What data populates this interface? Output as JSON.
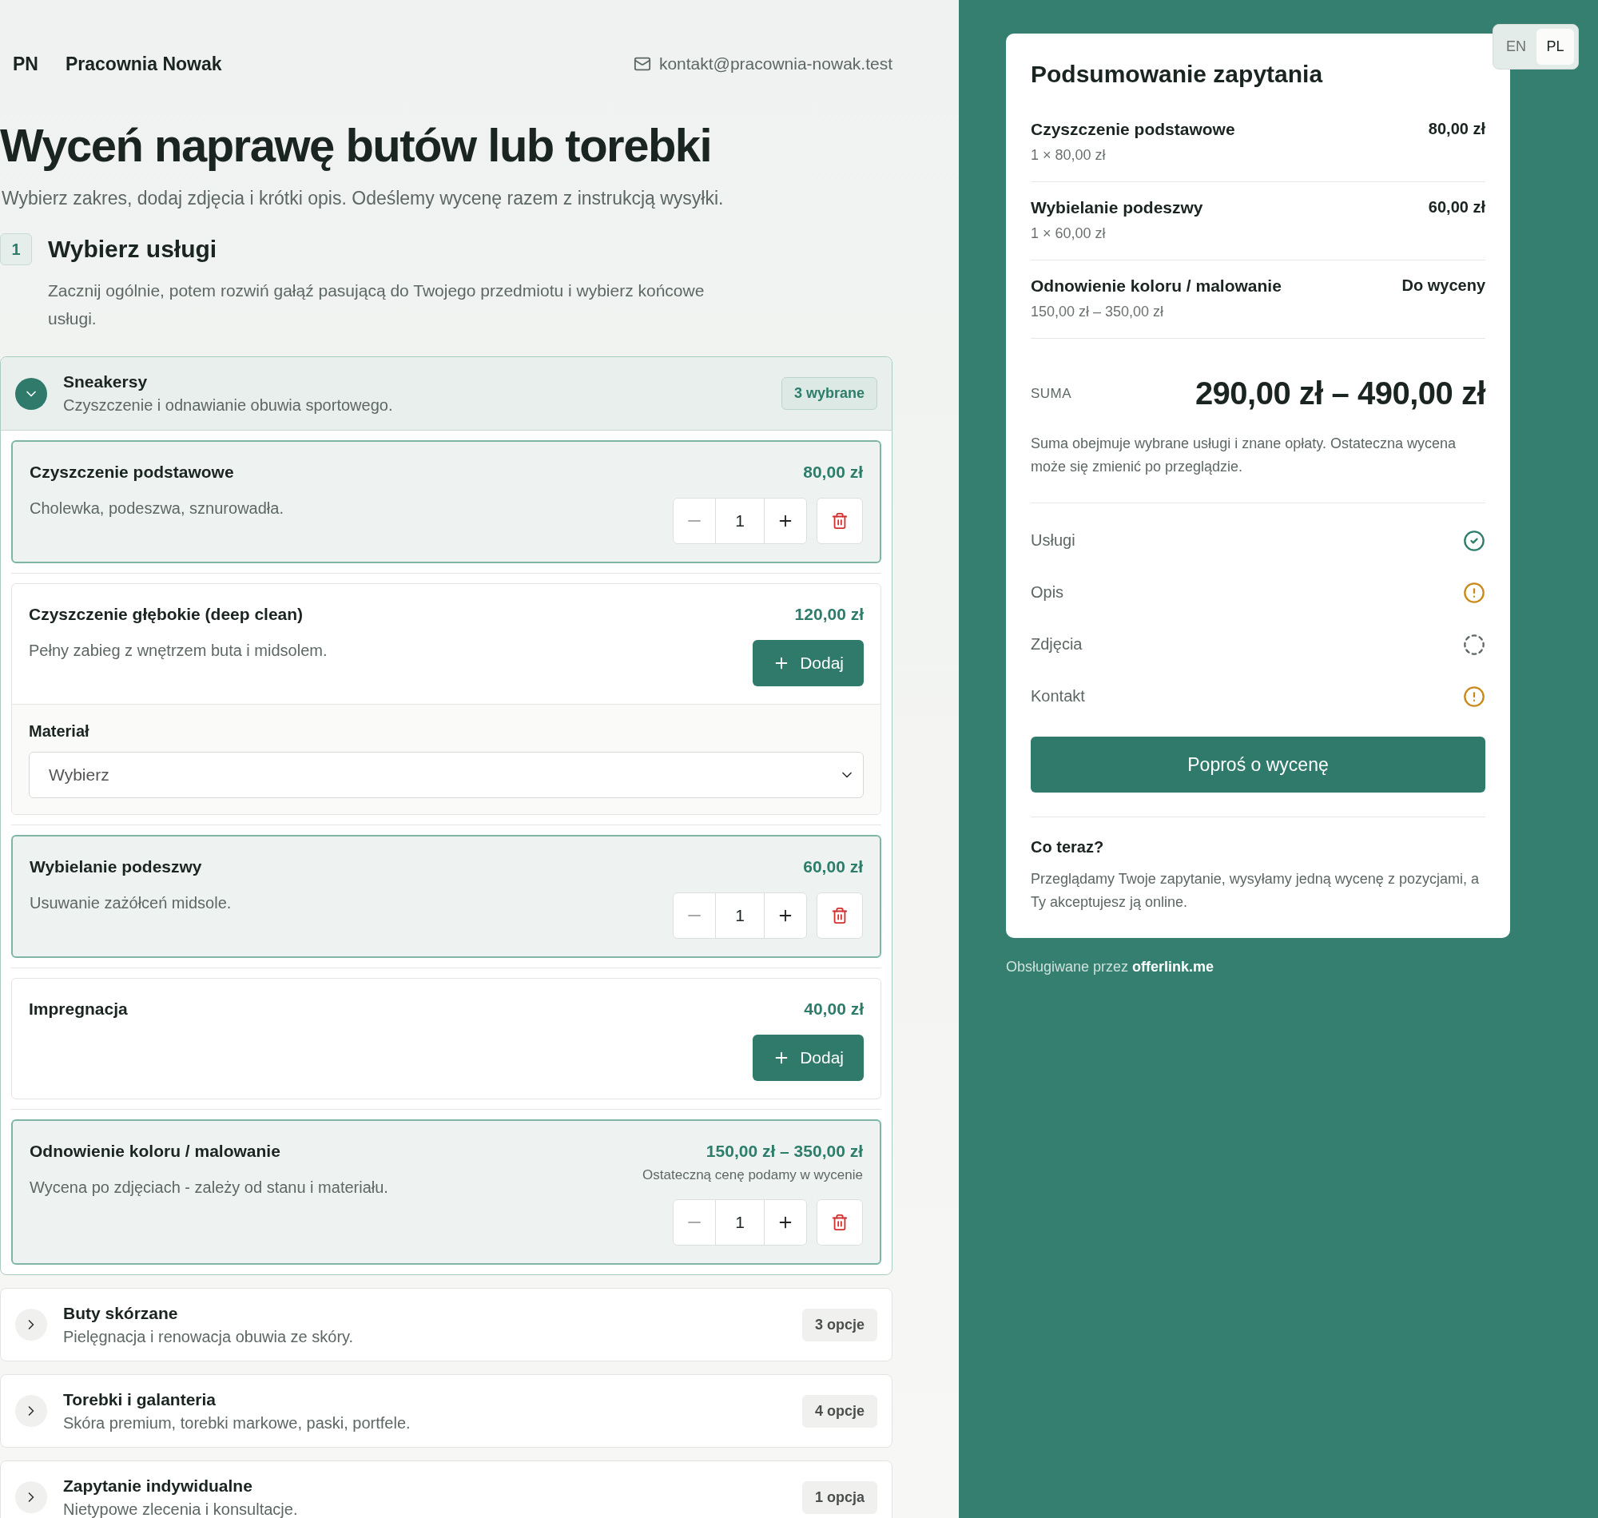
{
  "header": {
    "logo": "PN",
    "brand": "Pracownia Nowak",
    "email": "kontakt@pracownia-nowak.test"
  },
  "title": "Wyceń naprawę butów lub torebki",
  "subtitle": "Wybierz zakres, dodaj zdjęcia i krótki opis. Odeślemy wycenę razem z instrukcją wysyłki.",
  "step": {
    "number": "1",
    "title": "Wybierz usługi",
    "description": "Zacznij ogólnie, potem rozwiń gałąź pasującą do Twojego przedmiotu i wybierz końcowe usługi."
  },
  "categories": [
    {
      "name": "Sneakersy",
      "description": "Czyszczenie i odnawianie obuwia sportowego.",
      "badge": "3 wybrane",
      "expanded": true,
      "services": [
        {
          "name": "Czyszczenie podstawowe",
          "description": "Cholewka, podeszwa, sznurowadła.",
          "price": "80,00 zł",
          "selected": true,
          "quantity": "1"
        },
        {
          "name": "Czyszczenie głębokie (deep clean)",
          "description": "Pełny zabieg z wnętrzem buta i midsolem.",
          "price": "120,00 zł",
          "selected": false,
          "action": "Dodaj",
          "option": {
            "label": "Materiał",
            "value": "Wybierz"
          }
        },
        {
          "name": "Wybielanie podeszwy",
          "description": "Usuwanie zażółceń midsole.",
          "price": "60,00 zł",
          "selected": true,
          "quantity": "1"
        },
        {
          "name": "Impregnacja",
          "price": "40,00 zł",
          "selected": false,
          "action": "Dodaj"
        },
        {
          "name": "Odnowienie koloru / malowanie",
          "description": "Wycena po zdjęciach - zależy od stanu i materiału.",
          "price": "150,00 zł – 350,00 zł",
          "price_note": "Ostateczną cenę podamy w wycenie",
          "selected": true,
          "quantity": "1"
        }
      ]
    },
    {
      "name": "Buty skórzane",
      "description": "Pielęgnacja i renowacja obuwia ze skóry.",
      "badge": "3 opcje",
      "expanded": false
    },
    {
      "name": "Torebki i galanteria",
      "description": "Skóra premium, torebki markowe, paski, portfele.",
      "badge": "4 opcje",
      "expanded": false
    },
    {
      "name": "Zapytanie indywidualne",
      "description": "Nietypowe zlecenia i konsultacje.",
      "badge": "1 opcja",
      "expanded": false
    }
  ],
  "language_switch": [
    {
      "label": "EN",
      "selected": false
    },
    {
      "label": "PL",
      "selected": true
    }
  ],
  "summary": {
    "title": "Podsumowanie zapytania",
    "items": [
      {
        "name": "Czyszczenie podstawowe",
        "detail": "1 × 80,00 zł",
        "amount": "80,00 zł"
      },
      {
        "name": "Wybielanie podeszwy",
        "detail": "1 × 60,00 zł",
        "amount": "60,00 zł"
      },
      {
        "name": "Odnowienie koloru / malowanie",
        "detail": "150,00 zł – 350,00 zł",
        "amount": "Do wyceny"
      }
    ],
    "total_label": "SUMA",
    "total": "290,00 zł – 490,00 zł",
    "note": "Suma obejmuje wybrane usługi i znane opłaty. Ostateczna wycena może się zmienić po przeglądzie.",
    "checklist": [
      {
        "label": "Usługi",
        "kind": "done"
      },
      {
        "label": "Opis",
        "kind": "warning"
      },
      {
        "label": "Zdjęcia",
        "kind": "pending"
      },
      {
        "label": "Kontakt",
        "kind": "warning"
      }
    ],
    "button": "Poproś o wycenę",
    "next_title": "Co teraz?",
    "next_text": "Przeglądamy Twoje zapytanie, wysyłamy jedną wycenę z pozycjami, a Ty akceptujesz ją online."
  },
  "footer": "Obsługiwane przez **offerlink.me**"
}
